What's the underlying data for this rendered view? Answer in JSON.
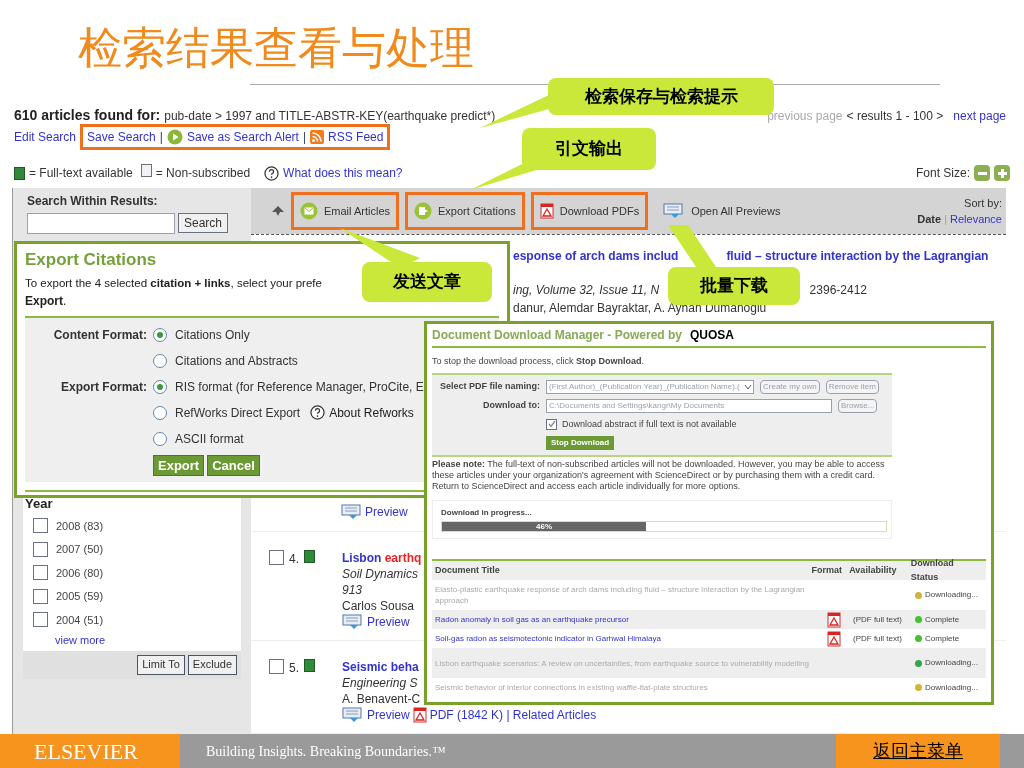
{
  "slide_title": "检索结果查看与处理",
  "results_header": {
    "count": "610 articles found for:",
    "query": "pub-date > 1997 and TITLE-ABSTR-KEY(earthquake predict*)",
    "previous": "previous page",
    "range": "< results 1 - 100 >",
    "next": "next page"
  },
  "search_links": {
    "separator": "|",
    "items": [
      {
        "label": "Edit Search",
        "kind": "plain",
        "highlighted": false
      },
      {
        "label": "Save Search",
        "kind": "plain",
        "highlighted": true
      },
      {
        "label": "Save as Search Alert",
        "kind": "alert",
        "highlighted": true
      },
      {
        "label": "RSS Feed",
        "kind": "feed",
        "highlighted": true
      }
    ]
  },
  "legend": {
    "full_text": "= Full-text available",
    "non_subscribed": "= Non-subscribed",
    "help": "What does this mean?",
    "font_size": "Font Size:"
  },
  "search_within": {
    "label": "Search Within Results:",
    "button": "Search"
  },
  "toolbar": [
    {
      "label": "Email Articles",
      "kind": "email",
      "highlighted": true
    },
    {
      "label": "Export Citations",
      "kind": "export",
      "highlighted": true
    },
    {
      "label": "Download PDFs",
      "kind": "pdf",
      "highlighted": true
    },
    {
      "label": "Open All Previews",
      "kind": "preview",
      "highlighted": false
    }
  ],
  "sort": {
    "label": "Sort by:",
    "separator": "|",
    "options": [
      {
        "label": "Date",
        "selected": true
      },
      {
        "label": "Relevance",
        "selected": false
      }
    ]
  },
  "year_filter": {
    "title": "Year",
    "items": [
      {
        "label": "2008 (83)",
        "checked": false
      },
      {
        "label": "2007 (50)",
        "checked": false
      },
      {
        "label": "2006 (80)",
        "checked": false
      },
      {
        "label": "2005 (59)",
        "checked": false
      },
      {
        "label": "2004 (51)",
        "checked": false
      }
    ],
    "more": "view more",
    "buttons": [
      "Limit To",
      "Exclude"
    ]
  },
  "partial_result": {
    "title": "esponse of arch dams includ",
    "title_rest": "fluid – structure interaction by the Lagrangian",
    "source": "ing, Volume 32, Issue 11, N",
    "pages": "2396-2412",
    "authors": "danur, Alemdar Bayraktar, A. Ayhan Dumanoglu",
    "preview": "Preview"
  },
  "results": [
    {
      "number": "4.",
      "checked": false,
      "full_text": true,
      "title": "Lisbon ",
      "title_hit": "earthq",
      "journal": "Soil Dynamics",
      "volume": "913",
      "authors": "Carlos Sousa",
      "preview": "Preview"
    },
    {
      "number": "5.",
      "checked": false,
      "full_text": true,
      "title": "Seismic beha",
      "journal": "Engineering S",
      "authors": "A. Benavent-C",
      "preview": "Preview",
      "pdf": "PDF (1842 K) | Related Articles"
    }
  ],
  "export_citations": {
    "title": "Export Citations",
    "instruction_line1": "To export the 4 selected **citation + links**, select your prefe",
    "instruction_line2": "**Export**.",
    "groups": [
      {
        "label": "Content Format:",
        "options": [
          {
            "label": "Citations Only",
            "selected": true
          },
          {
            "label": "Citations and Abstracts",
            "selected": false
          }
        ]
      },
      {
        "label": "Export Format:",
        "options": [
          {
            "label": "RIS format (for Reference Manager, ProCite, E",
            "selected": true
          },
          {
            "label": "RefWorks Direct Export",
            "selected": false,
            "help": "About Refworks"
          },
          {
            "label": "ASCII format",
            "selected": false
          }
        ]
      }
    ],
    "buttons": [
      "Export",
      "Cancel"
    ]
  },
  "download_manager": {
    "title": "Document Download Manager - Powered by",
    "brand": "QUOSA",
    "instruction": "To stop the download process, click **Stop Download**.",
    "naming_label": "Select PDF file naming:",
    "naming_value": "(First Author)_(Publication Year)_(Publication Name).(",
    "create": "Create my own",
    "remove": "Remove item",
    "download_to_label": "Download to:",
    "download_to_value": "C:\\Documents and Settings\\kangr\\My Documents",
    "browse": "Browse...",
    "abstract_option": {
      "label": "Download abstract if full text is not available",
      "checked": true
    },
    "stop": "Stop Download",
    "note": "**Please note:** The full-text of non-subscribed articles will not be downloaded. However, you may be able to access these articles under your organization's agreement with ScienceDirect or by purchasing them with a credit card. Return to ScienceDirect and access each article individually for more options.",
    "progress": {
      "label": "Download in progress...",
      "level": 0.46,
      "reading": "46%"
    },
    "columns": [
      "Document Title",
      "Format",
      "Availability",
      "Download Status"
    ],
    "rows": [
      {
        "title": "Elasto-plastic earthquake response of arch dams including fluid – structure interaction by the Lagrangian approach",
        "available": false,
        "has_pdf": false,
        "status": "Downloading...",
        "color": "#d4b23c"
      },
      {
        "title": "Radon anomaly in soil gas as an earthquake precursor",
        "available": true,
        "has_pdf": true,
        "availability": "(PDF full text)",
        "status": "Complete",
        "color": "#44c22e"
      },
      {
        "title": "Soil-gas radon as seismotectonic indicator in Garhwal Himalaya",
        "available": true,
        "has_pdf": true,
        "availability": "(PDF full text)",
        "status": "Complete",
        "color": "#44c22e"
      },
      {
        "title": "Lisbon earthquake scenarios: A review on uncertainties, from earthquake source to vulnerability modelling",
        "available": false,
        "has_pdf": false,
        "status": "Downloading...",
        "color": "#2fa84a"
      },
      {
        "title": "Seismic behavior of interior connections in existing waffle-flat-plate structures",
        "available": false,
        "has_pdf": false,
        "status": "Downloading...",
        "color": "#d4b23c"
      }
    ]
  },
  "callouts": [
    {
      "text": "检索保存与检索提示"
    },
    {
      "text": "引文输出"
    },
    {
      "text": "发送文章"
    },
    {
      "text": "批量下载"
    }
  ],
  "footer": {
    "publisher": "ELSEVIER",
    "tagline": "Building Insights. Breaking Boundaries.™",
    "back": "返回主菜单"
  }
}
